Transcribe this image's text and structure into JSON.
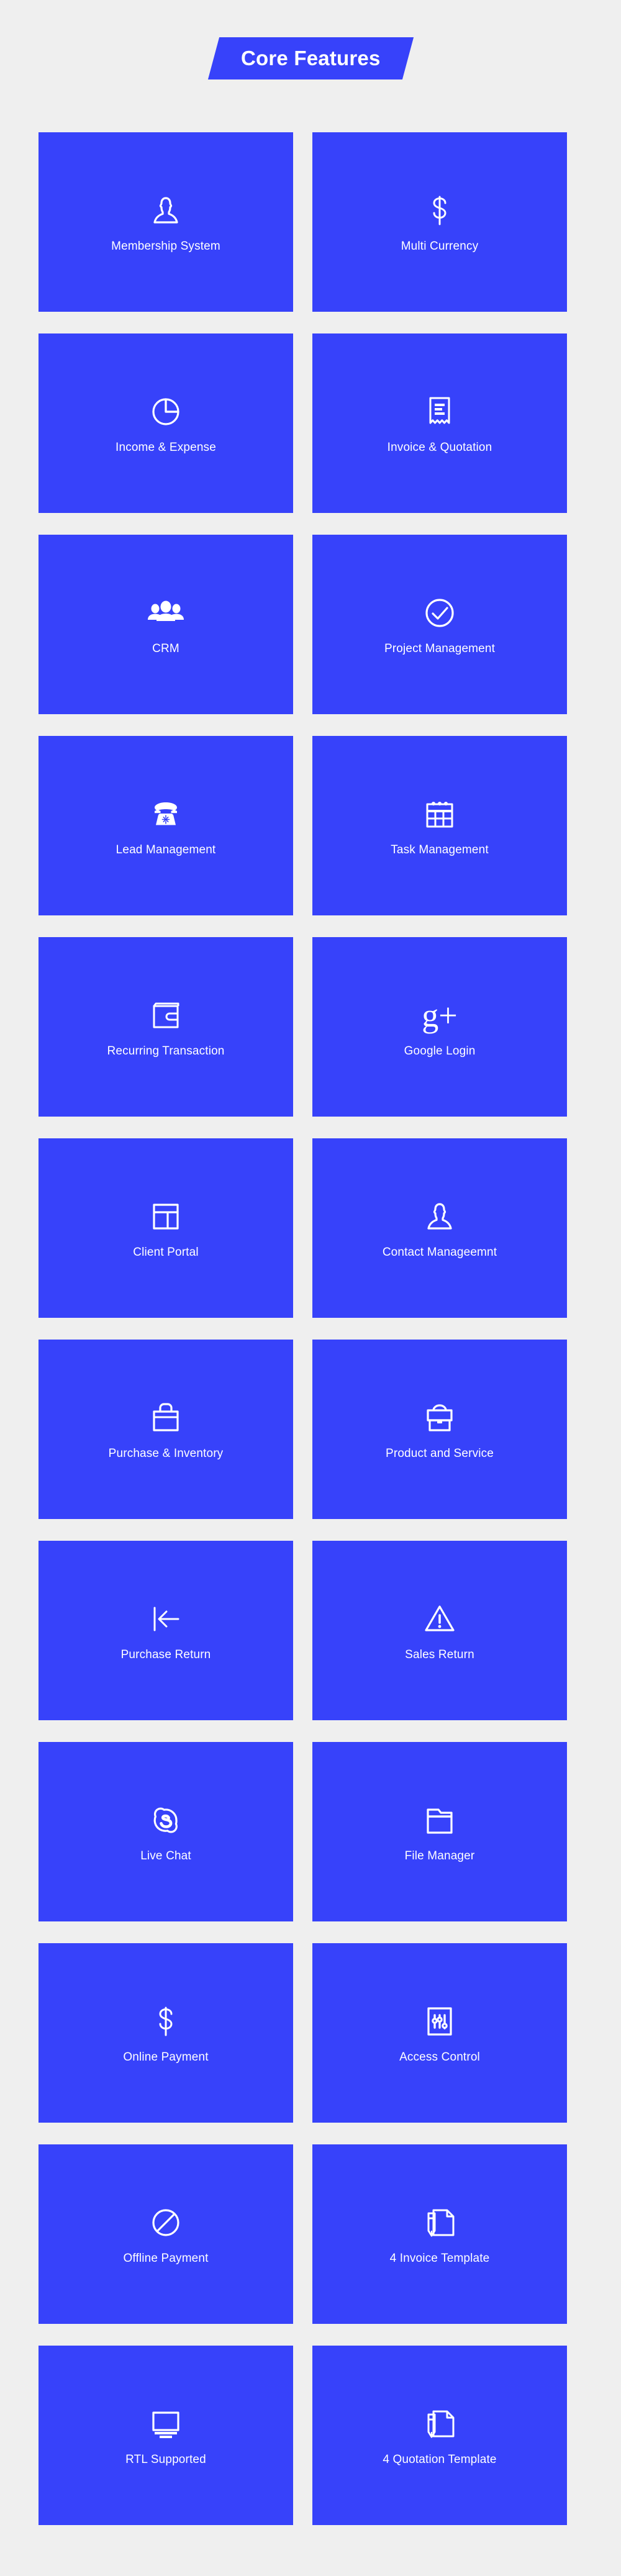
{
  "section": {
    "heading": "Core Features",
    "accent_color": "#3742fa",
    "background_color": "#efefef",
    "text_color": "#ffffff"
  },
  "features": [
    {
      "label": "Membership System",
      "icon": "user-outline-icon"
    },
    {
      "label": "Multi Currency",
      "icon": "dollar-sign-icon"
    },
    {
      "label": "Income & Expense",
      "icon": "pie-chart-icon"
    },
    {
      "label": "Invoice & Quotation",
      "icon": "receipt-icon"
    },
    {
      "label": "CRM",
      "icon": "users-group-icon"
    },
    {
      "label": "Project Management",
      "icon": "check-circle-icon"
    },
    {
      "label": "Lead Management",
      "icon": "telephone-icon"
    },
    {
      "label": "Task Management",
      "icon": "calendar-icon"
    },
    {
      "label": "Recurring Transaction",
      "icon": "wallet-icon"
    },
    {
      "label": "Google Login",
      "icon": "google-plus-icon"
    },
    {
      "label": "Client Portal",
      "icon": "layout-dashboard-icon"
    },
    {
      "label": "Contact Manageemnt",
      "icon": "contact-person-icon"
    },
    {
      "label": "Purchase & Inventory",
      "icon": "shopping-bag-icon"
    },
    {
      "label": "Product and Service",
      "icon": "briefcase-icon"
    },
    {
      "label": "Purchase Return",
      "icon": "arrow-left-to-bar-icon"
    },
    {
      "label": "Sales Return",
      "icon": "warning-triangle-icon"
    },
    {
      "label": "Live Chat",
      "icon": "skype-icon"
    },
    {
      "label": "File Manager",
      "icon": "folder-icon"
    },
    {
      "label": "Online Payment",
      "icon": "dollar-sign-icon"
    },
    {
      "label": "Access Control",
      "icon": "sliders-box-icon"
    },
    {
      "label": "Offline Payment",
      "icon": "ban-circle-icon"
    },
    {
      "label": "4 Invoice Template",
      "icon": "document-pencil-icon"
    },
    {
      "label": "RTL Supported",
      "icon": "monitor-icon"
    },
    {
      "label": "4 Quotation Template",
      "icon": "document-pencil-icon"
    }
  ]
}
